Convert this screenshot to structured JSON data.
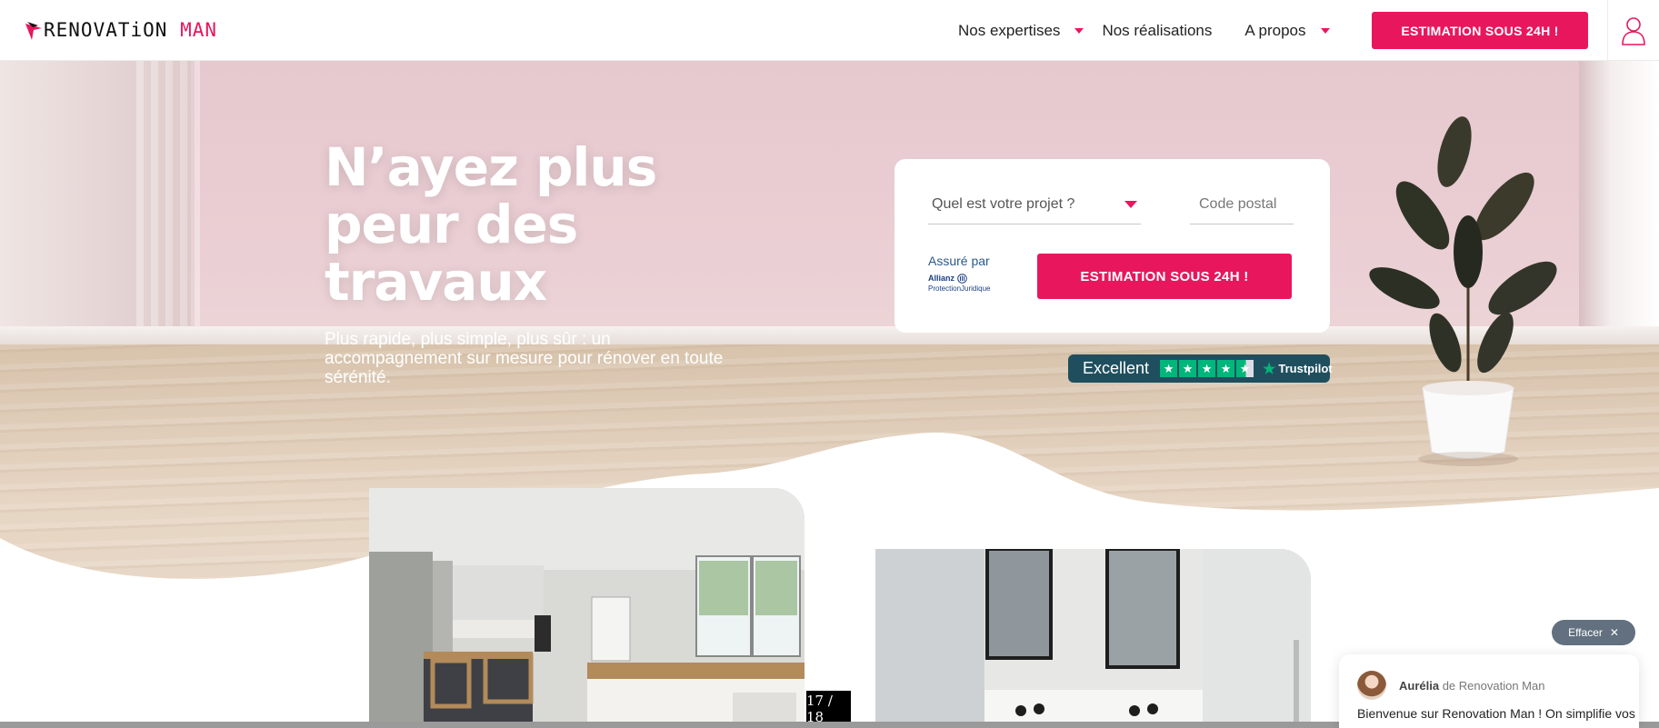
{
  "brand": {
    "logo_part1": "RENOVATiON",
    "logo_part2": "MAN",
    "accent_color": "#e8175d"
  },
  "nav": {
    "items": [
      {
        "label": "Nos expertises",
        "has_dropdown": true
      },
      {
        "label": "Nos réalisations",
        "has_dropdown": false
      },
      {
        "label": "A propos",
        "has_dropdown": true
      }
    ],
    "cta_label": "ESTIMATION SOUS 24H !",
    "account_icon": "user-icon"
  },
  "hero": {
    "title": "N’ayez plus peur des travaux",
    "subtitle": "Plus rapide, plus simple, plus sûr : un accompagnement sur mesure pour rénover en toute sérénité."
  },
  "form": {
    "project_placeholder": "Quel est votre projet ?",
    "postal_placeholder": "Code postal",
    "insured_by": "Assuré par",
    "insurer_name": "Allianz",
    "insurer_sub": "ProtectionJuridique",
    "cta_label": "ESTIMATION SOUS 24H !"
  },
  "trustpilot": {
    "rating_label": "Excellent",
    "stars": 4.5,
    "brand": "Trustpilot"
  },
  "gallery": {
    "counter": "17 / 18"
  },
  "chat": {
    "clear_label": "Effacer",
    "agent_name": "Aurélia",
    "agent_org": "de Renovation Man",
    "message": "Bienvenue sur Renovation Man ! On simplifie vos"
  }
}
